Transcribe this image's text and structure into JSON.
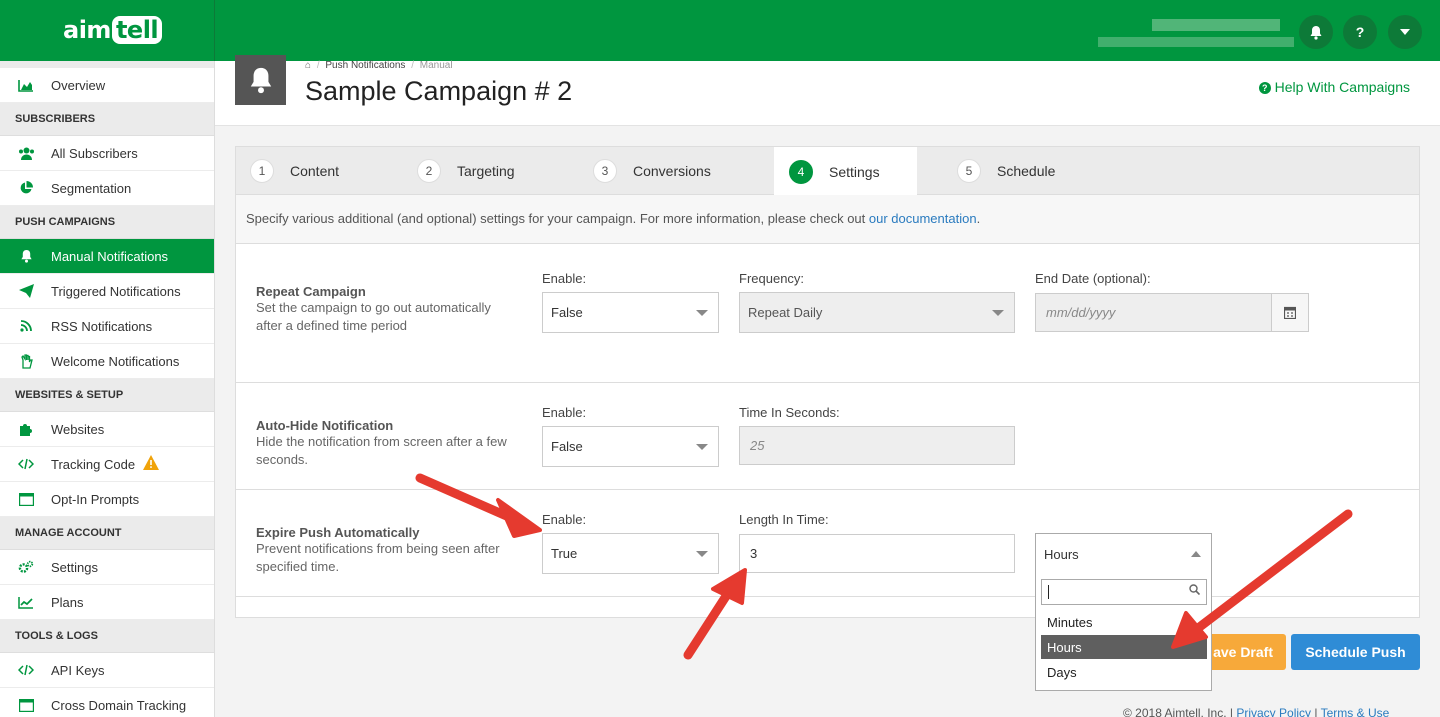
{
  "brand": {
    "logo_a": "aim",
    "logo_b": "tell",
    "accent": "#00963f"
  },
  "topbar": {
    "buttons": [
      {
        "name": "bell-icon",
        "glyph": "▲"
      },
      {
        "name": "help-icon",
        "glyph": "?"
      },
      {
        "name": "chevron-down-icon",
        "glyph": "▾"
      }
    ]
  },
  "sidebar": {
    "overview": "Overview",
    "sec_subscribers": "SUBSCRIBERS",
    "all_subscribers": "All Subscribers",
    "segmentation": "Segmentation",
    "sec_push": "PUSH CAMPAIGNS",
    "manual": "Manual Notifications",
    "triggered": "Triggered Notifications",
    "rss": "RSS Notifications",
    "welcome": "Welcome Notifications",
    "sec_websites": "WEBSITES & SETUP",
    "websites": "Websites",
    "tracking": "Tracking Code",
    "optin": "Opt-In Prompts",
    "sec_account": "MANAGE ACCOUNT",
    "settings": "Settings",
    "plans": "Plans",
    "sec_tools": "TOOLS & LOGS",
    "api": "API Keys",
    "cross": "Cross Domain Tracking"
  },
  "header": {
    "crumb_1": "Push Notifications",
    "crumb_sep": "/",
    "crumb_2": "Manual",
    "title": "Sample Campaign # 2",
    "help": "Help With Campaigns"
  },
  "tabs": [
    {
      "num": "1",
      "label": "Content"
    },
    {
      "num": "2",
      "label": "Targeting"
    },
    {
      "num": "3",
      "label": "Conversions"
    },
    {
      "num": "4",
      "label": "Settings"
    },
    {
      "num": "5",
      "label": "Schedule"
    }
  ],
  "intro": {
    "text": "Specify various additional (and optional) settings for your campaign. For more information, please check out ",
    "link": "our documentation",
    "end": "."
  },
  "repeat": {
    "title": "Repeat Campaign",
    "desc": "Set the campaign to go out automatically after a defined time period",
    "enable_label": "Enable:",
    "enable_value": "False",
    "freq_label": "Frequency:",
    "freq_value": "Repeat Daily",
    "end_label": "End Date (optional):",
    "end_placeholder": "mm/dd/yyyy"
  },
  "autohide": {
    "title": "Auto-Hide Notification",
    "desc": "Hide the notification from screen after a few seconds.",
    "enable_label": "Enable:",
    "enable_value": "False",
    "time_label": "Time In Seconds:",
    "time_placeholder": "25"
  },
  "expire": {
    "title": "Expire Push Automatically",
    "desc": "Prevent notifications from being seen after specified time.",
    "enable_label": "Enable:",
    "enable_value": "True",
    "length_label": "Length In Time:",
    "length_value": "3",
    "unit_value": "Hours",
    "unit_options": [
      "Minutes",
      "Hours",
      "Days"
    ]
  },
  "buttons": {
    "draft": "ave Draft",
    "push": "Schedule Push"
  },
  "footer": {
    "copy": "© 2018 Aimtell, Inc. | ",
    "privacy": "Privacy Policy",
    "sep": " | ",
    "terms": "Terms & Use"
  }
}
